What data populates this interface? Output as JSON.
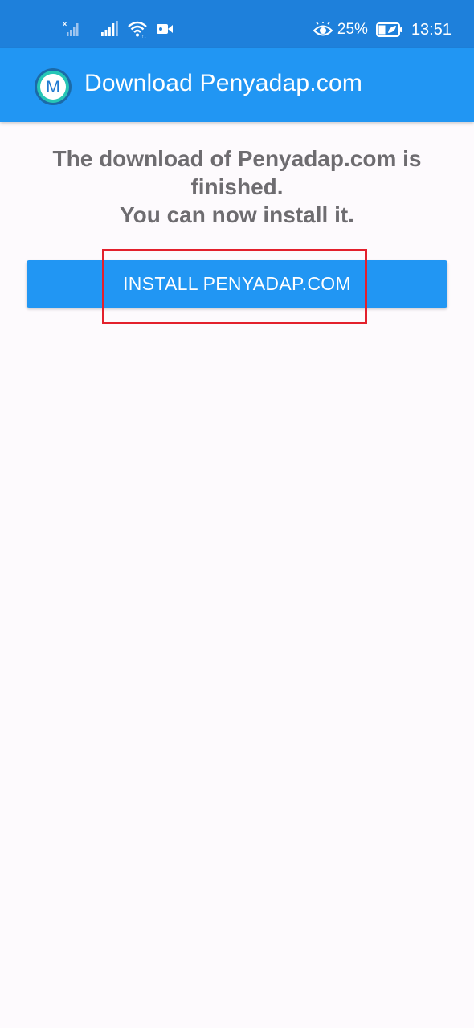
{
  "status_bar": {
    "battery_percent": "25%",
    "time": "13:51",
    "icons": [
      "sim-no-signal-icon",
      "cell-signal-icon",
      "wifi-icon",
      "video-camera-icon",
      "eye-comfort-icon",
      "battery-charging-icon"
    ]
  },
  "app_bar": {
    "logo_letter": "M",
    "title": "Download Penyadap.com",
    "colors": {
      "bar": "#2196f3",
      "status": "#1e80db"
    }
  },
  "content": {
    "message_line1": "The download of Penyadap.com is finished.",
    "message_line2": "You can now install it.",
    "install_button_label": "INSTALL PENYADAP.COM",
    "colors": {
      "message_text": "#6e6c70",
      "button": "#2196f3",
      "highlight": "#e3202c"
    }
  }
}
